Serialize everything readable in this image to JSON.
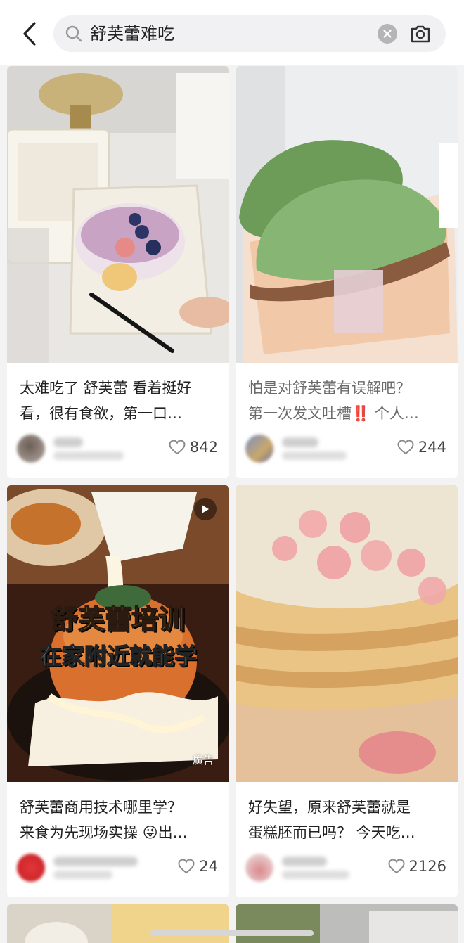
{
  "search": {
    "query": "舒芙蕾难吃"
  },
  "icons": {
    "back": "chevron-left-icon",
    "search": "magnifier-icon",
    "clear": "clear-x-icon",
    "camera": "camera-scan-icon",
    "like": "heart-outline-icon",
    "play": "play-icon"
  },
  "colors": {
    "like_heart": "#8a8a8a",
    "warning_marks": "#e02020",
    "overlay_text": "#ffe23a"
  },
  "posts": [
    {
      "title_line1": "太难吃了 舒芙蕾 看着挺好",
      "title_line2": "看，很有食欲，第一口…",
      "likes": "842"
    },
    {
      "title_line1": "怕是对舒芙蕾有误解吧？",
      "title_line2_a": "第一次发文吐槽",
      "title_line2_mark": "‼️",
      "title_line2_b": " 个人…",
      "likes": "244"
    },
    {
      "title_line1": "舒芙蕾商用技术哪里学？",
      "title_line2_a": "来食为先现场实操 ",
      "title_line2_emoji": "😜",
      "title_line2_b": "出…",
      "likes": "24",
      "overlay_line1": "舒芙蕾培训",
      "overlay_line2": "在家附近就能学",
      "ad_label": "廣告"
    },
    {
      "title_line1": "好失望，原来舒芙蕾就是",
      "title_line2": "蛋糕胚而已吗？ 今天吃…",
      "likes": "2126"
    }
  ]
}
